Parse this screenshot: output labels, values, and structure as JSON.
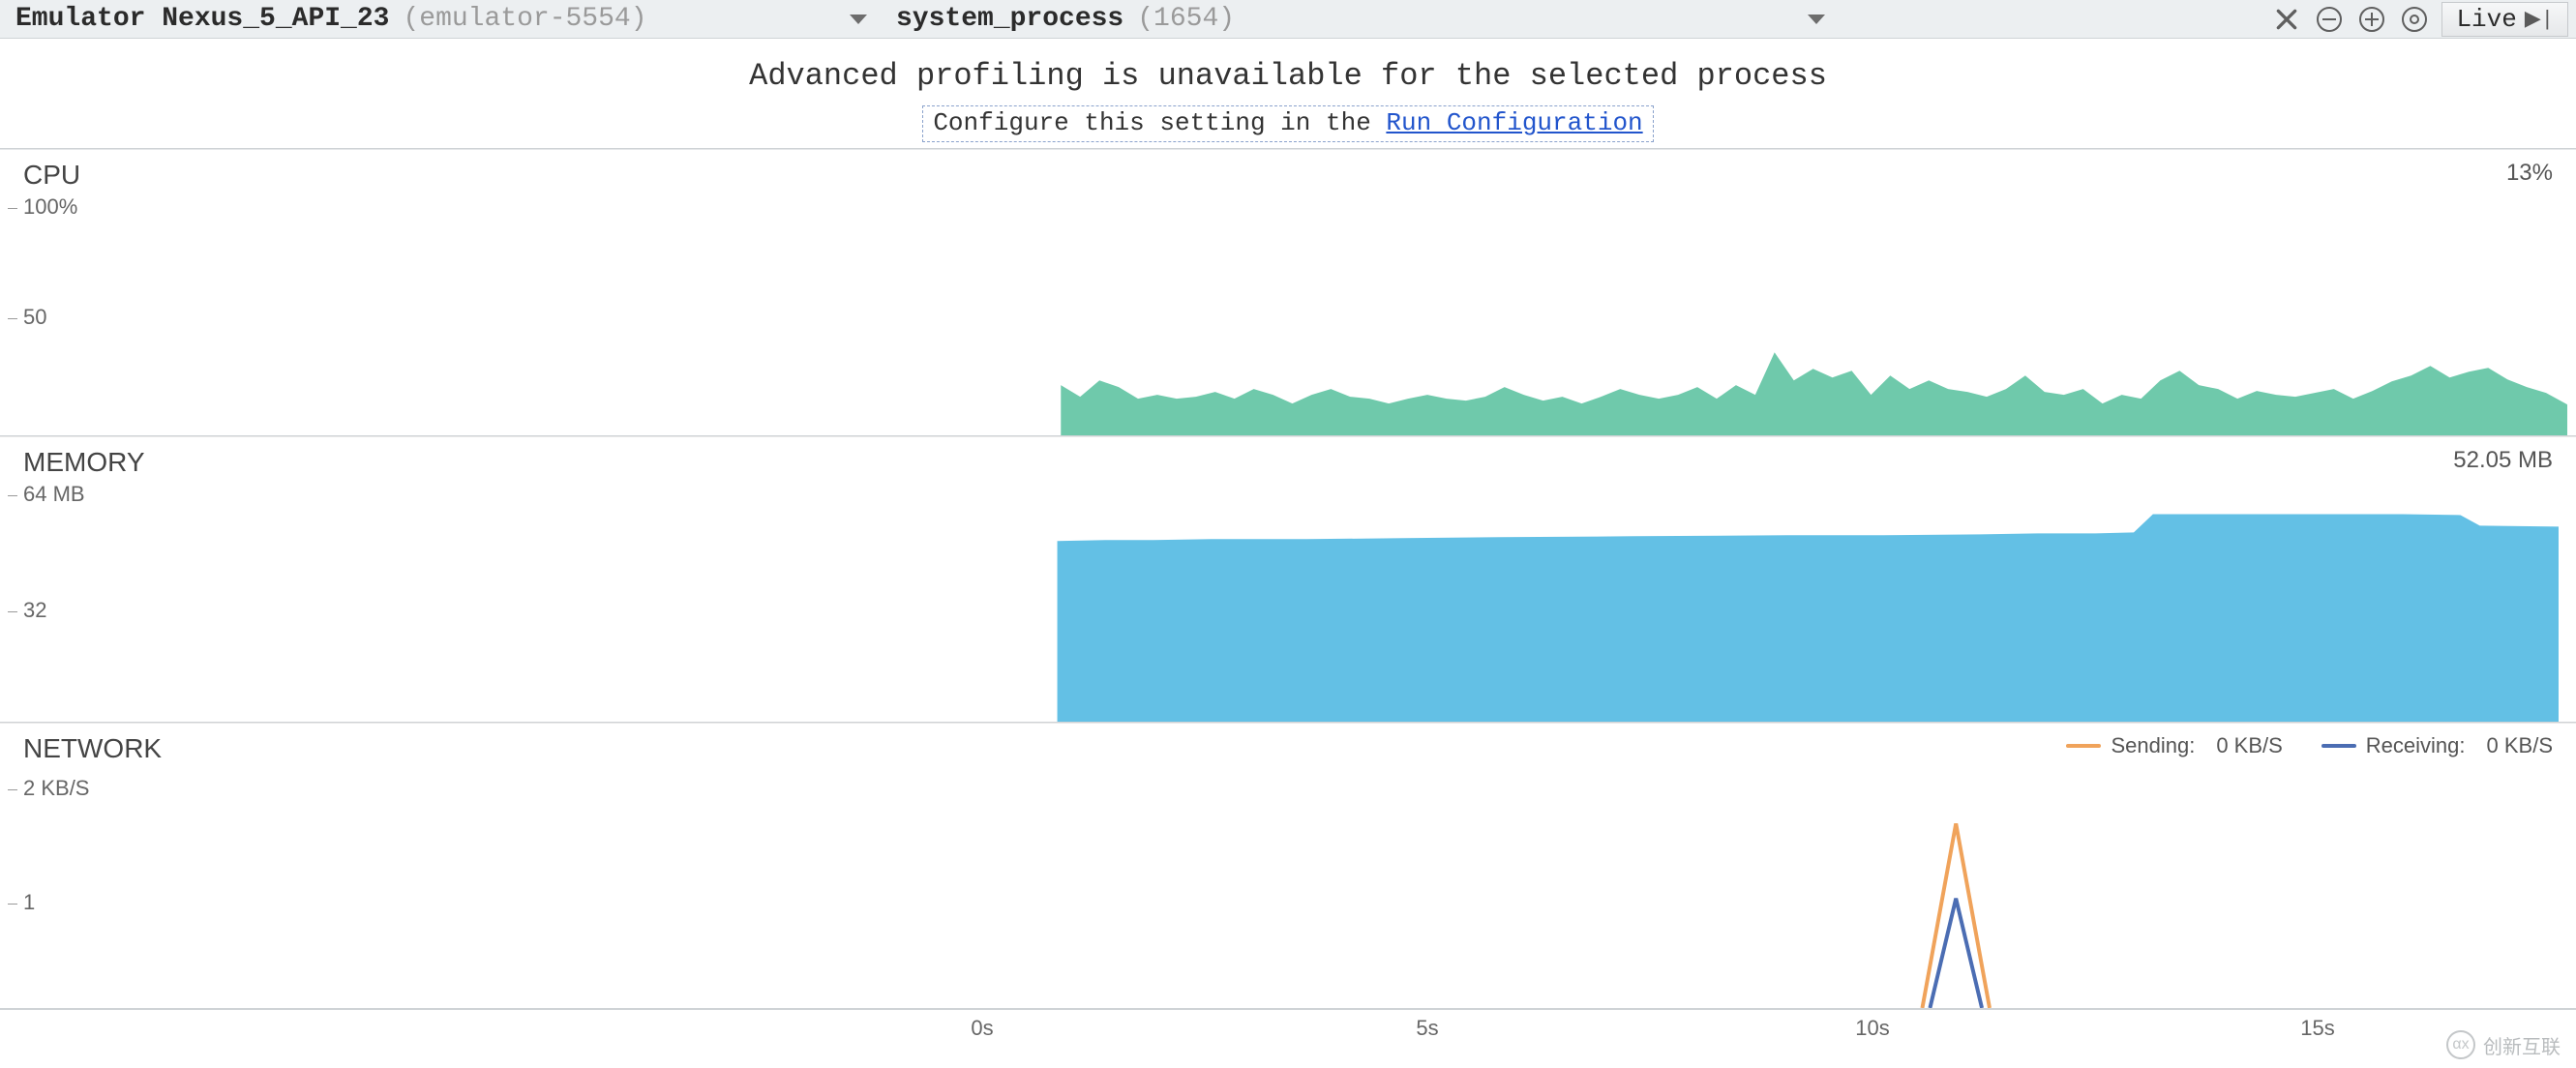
{
  "toolbar": {
    "device_dropdown": {
      "main": "Emulator Nexus_5_API_23",
      "sub": "(emulator-5554)"
    },
    "process_dropdown": {
      "main": "system_process",
      "sub": "(1654)"
    },
    "live_label": "Live"
  },
  "message": {
    "line1": "Advanced profiling is unavailable for the selected process",
    "line2_prefix": "Configure this setting in the ",
    "line2_link": "Run Configuration"
  },
  "cpu": {
    "title": "CPU",
    "value": "13%",
    "ytick_top": "100%",
    "ytick_mid": "50"
  },
  "memory": {
    "title": "MEMORY",
    "value": "52.05 MB",
    "ytick_top": "64 MB",
    "ytick_mid": "32"
  },
  "network": {
    "title": "NETWORK",
    "ytick_top": "2 KB/S",
    "ytick_mid": "1",
    "legend": {
      "sending_label": "Sending:",
      "sending_value": "0 KB/S",
      "receiving_label": "Receiving:",
      "receiving_value": "0 KB/S"
    }
  },
  "timeaxis": {
    "ticks": [
      "0s",
      "5s",
      "10s",
      "15s"
    ]
  },
  "watermark": "创新互联",
  "chart_data": [
    {
      "type": "area",
      "name": "CPU",
      "title": "CPU",
      "ylabel": "%",
      "ylim": [
        0,
        100
      ],
      "xlim_seconds": [
        -5,
        17.5
      ],
      "current_value_percent": 13,
      "x_seconds": [
        0,
        0.3,
        0.6,
        0.9,
        1.2,
        1.5,
        1.8,
        2.1,
        2.4,
        2.7,
        3,
        3.3,
        3.6,
        3.9,
        4.2,
        4.5,
        4.8,
        5.1,
        5.4,
        5.7,
        6,
        6.3,
        6.6,
        6.9,
        7.2,
        7.5,
        7.8,
        8.1,
        8.4,
        8.7,
        9,
        9.3,
        9.6,
        9.9,
        10.2,
        10.5,
        10.8,
        11.1,
        11.4,
        11.7,
        12,
        12.3,
        12.6,
        12.9,
        13.2,
        13.5,
        13.8,
        14.1,
        14.4,
        14.7,
        15,
        15.3,
        15.6,
        15.9,
        16.2,
        16.5,
        16.8,
        17.1,
        17.4,
        17.5
      ],
      "values_percent": [
        22,
        17,
        24,
        21,
        16,
        18,
        16,
        17,
        19,
        16,
        20,
        18,
        14,
        18,
        20,
        17,
        16,
        14,
        16,
        18,
        16,
        15,
        17,
        21,
        18,
        15,
        17,
        14,
        17,
        20,
        18,
        16,
        18,
        21,
        16,
        22,
        18,
        36,
        24,
        29,
        25,
        28,
        18,
        26,
        20,
        24,
        20,
        19,
        17,
        20,
        26,
        19,
        18,
        20,
        14,
        18,
        16,
        24,
        28,
        13
      ]
    },
    {
      "type": "area",
      "name": "MEMORY",
      "title": "MEMORY",
      "ylabel": "MB",
      "ylim": [
        0,
        64
      ],
      "xlim_seconds": [
        -5,
        17.5
      ],
      "current_value_mb": 52.05,
      "x_seconds": [
        0,
        1,
        2,
        3,
        4,
        5,
        6,
        7,
        8,
        9,
        10,
        11,
        12,
        13,
        13.2,
        14,
        15,
        15.8,
        16,
        17,
        17.5
      ],
      "values_mb": [
        49,
        49,
        49.4,
        49.4,
        49.4,
        49.6,
        49.6,
        49.8,
        50,
        50,
        50,
        50,
        50.5,
        50.6,
        55.6,
        55.6,
        55.6,
        55.4,
        52.2,
        52.1,
        52.05
      ]
    },
    {
      "type": "line",
      "name": "NETWORK",
      "title": "NETWORK",
      "ylabel": "KB/S",
      "ylim": [
        0,
        2
      ],
      "xlim_seconds": [
        -5,
        17.5
      ],
      "series": [
        {
          "name": "Sending",
          "color": "#f0a35b",
          "current_value_kbs": 0,
          "x_seconds": [
            11.3,
            11.7,
            12.1
          ],
          "values_kbs": [
            0,
            1.6,
            0
          ]
        },
        {
          "name": "Receiving",
          "color": "#4b6db3",
          "current_value_kbs": 0,
          "x_seconds": [
            11.4,
            11.7,
            12.0
          ],
          "values_kbs": [
            0,
            0.95,
            0
          ]
        }
      ]
    }
  ]
}
